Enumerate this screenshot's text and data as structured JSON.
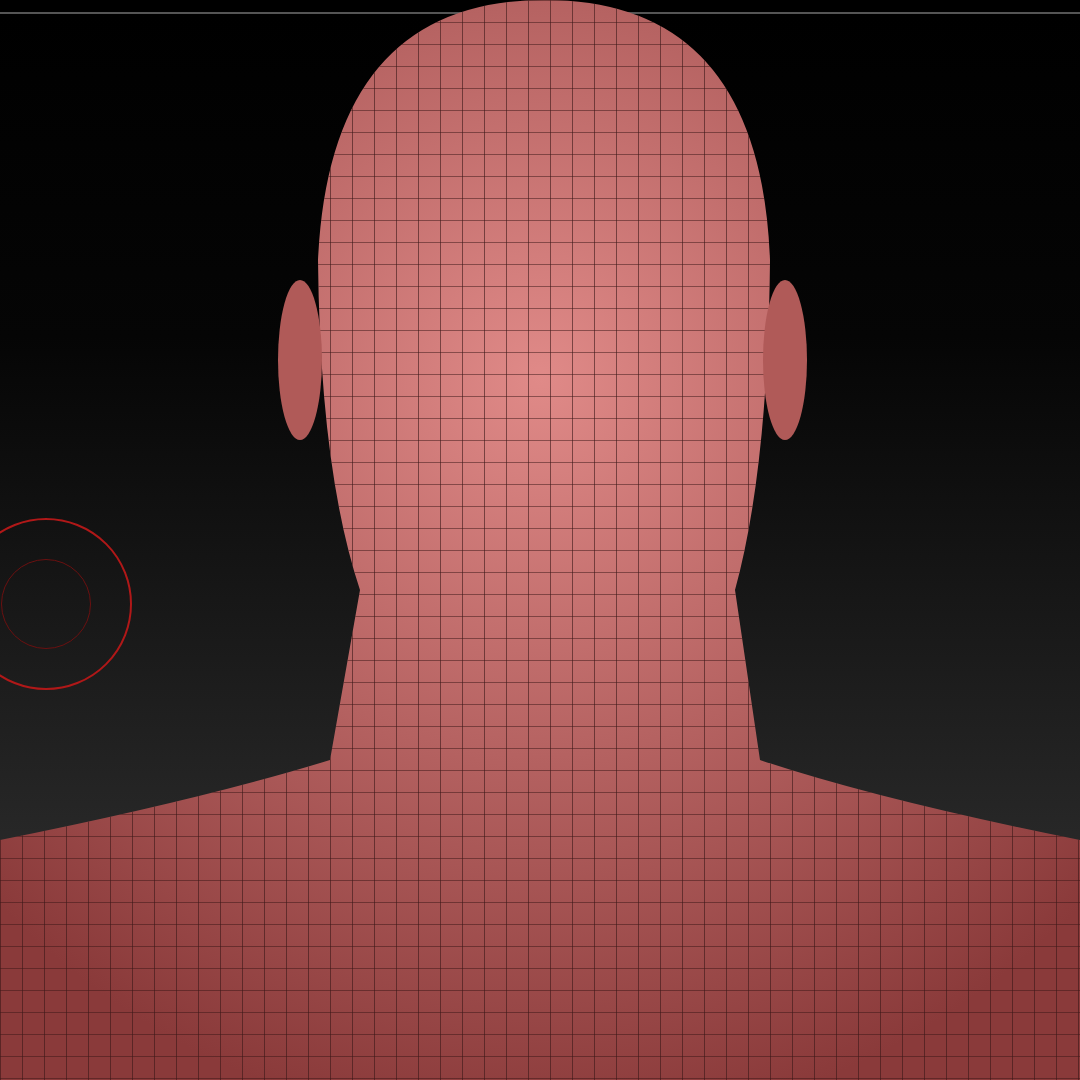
{
  "viewport": {
    "kind": "sculpt",
    "brush_cursor": true
  }
}
